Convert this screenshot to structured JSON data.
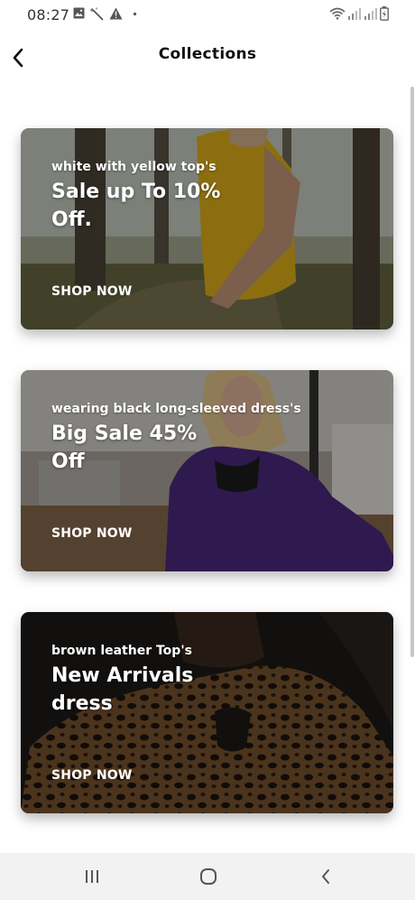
{
  "status_bar": {
    "time": "08:27",
    "left_icons": [
      "image-icon",
      "magic-wand-icon",
      "warning-icon",
      "dot-icon"
    ],
    "right_icons": [
      "wifi-icon",
      "signal-icon",
      "signal-icon",
      "battery-icon"
    ]
  },
  "header": {
    "back_icon": "chevron-left-icon",
    "title": "Collections"
  },
  "collections": [
    {
      "subtitle": "white with yellow top's",
      "headline": "Sale up To 10% Off.",
      "cta": "SHOP NOW"
    },
    {
      "subtitle": "wearing black long-sleeved dress's",
      "headline": "Big Sale 45% Off",
      "cta": "SHOP NOW"
    },
    {
      "subtitle": "brown leather Top's",
      "headline": "New Arrivals dress",
      "cta": "SHOP NOW"
    }
  ],
  "nav_bar": {
    "buttons": [
      "recent-apps-icon",
      "home-icon",
      "back-icon"
    ]
  },
  "colors": {
    "background": "#ffffff",
    "nav_bar": "#f2f2f2",
    "card_text": "#ffffff",
    "title": "#111111"
  }
}
